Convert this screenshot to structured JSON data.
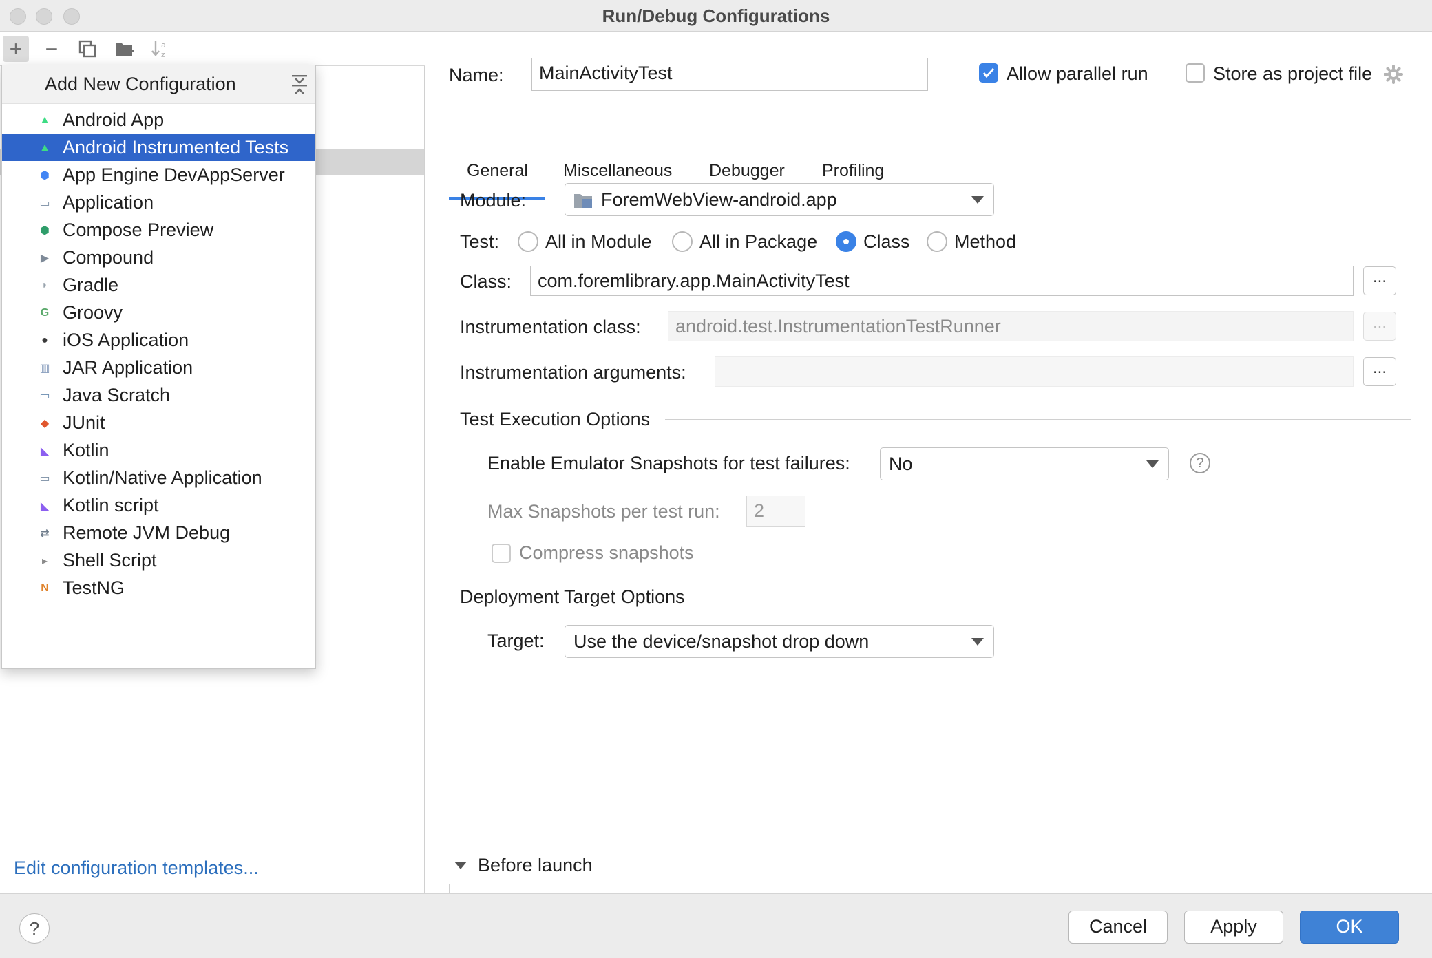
{
  "window": {
    "title": "Run/Debug Configurations"
  },
  "left": {
    "toolbar": {
      "add": "+",
      "remove": "−",
      "copy": "⧉",
      "folder": "📁",
      "sort": "↓ᵃᶻ"
    },
    "templates_link": "Edit configuration templates..."
  },
  "popup": {
    "title": "Add New Configuration",
    "items": [
      {
        "label": "Android App",
        "icon": "android-icon",
        "color": "#3ddc84"
      },
      {
        "label": "Android Instrumented Tests",
        "icon": "android-test-icon",
        "color": "#3ddc84",
        "selected": true
      },
      {
        "label": "App Engine DevAppServer",
        "icon": "app-engine-icon",
        "color": "#4285f4"
      },
      {
        "label": "Application",
        "icon": "application-icon",
        "color": "#7a8ea3"
      },
      {
        "label": "Compose Preview",
        "icon": "compose-icon",
        "color": "#2f9d6a"
      },
      {
        "label": "Compound",
        "icon": "compound-icon",
        "color": "#7e8a98"
      },
      {
        "label": "Gradle",
        "icon": "gradle-icon",
        "color": "#98a3ad"
      },
      {
        "label": "Groovy",
        "icon": "groovy-icon",
        "color": "#59a869"
      },
      {
        "label": "iOS Application",
        "icon": "apple-icon",
        "color": "#3a3a3a"
      },
      {
        "label": "JAR Application",
        "icon": "jar-icon",
        "color": "#8da2c0"
      },
      {
        "label": "Java Scratch",
        "icon": "java-scratch-icon",
        "color": "#6a8cb0"
      },
      {
        "label": "JUnit",
        "icon": "junit-icon",
        "color": "#e0572e"
      },
      {
        "label": "Kotlin",
        "icon": "kotlin-icon",
        "color": "#8c5ff0"
      },
      {
        "label": "Kotlin/Native Application",
        "icon": "kotlin-native-icon",
        "color": "#7a8ea3"
      },
      {
        "label": "Kotlin script",
        "icon": "kotlin-script-icon",
        "color": "#8c5ff0"
      },
      {
        "label": "Remote JVM Debug",
        "icon": "remote-debug-icon",
        "color": "#6f7d8c"
      },
      {
        "label": "Shell Script",
        "icon": "shell-icon",
        "color": "#8a8a8a"
      },
      {
        "label": "TestNG",
        "icon": "testng-icon",
        "color": "#e0842e"
      }
    ]
  },
  "config": {
    "name_label": "Name:",
    "name_value": "MainActivityTest",
    "allow_parallel_label": "Allow parallel run",
    "allow_parallel_checked": true,
    "store_project_label": "Store as project file",
    "store_project_checked": false,
    "tabs": [
      "General",
      "Miscellaneous",
      "Debugger",
      "Profiling"
    ],
    "active_tab": "General",
    "module_label": "Module:",
    "module_value": "ForemWebView-android.app",
    "test_label": "Test:",
    "test_options": [
      "All in Module",
      "All in Package",
      "Class",
      "Method"
    ],
    "test_selected": "Class",
    "class_label": "Class:",
    "class_value": "com.foremlibrary.app.MainActivityTest",
    "instr_class_label": "Instrumentation class:",
    "instr_class_value": "android.test.InstrumentationTestRunner",
    "instr_args_label": "Instrumentation arguments:",
    "instr_args_value": "",
    "dots": "...",
    "test_exec_heading": "Test Execution Options",
    "snapshots_label": "Enable Emulator Snapshots for test failures:",
    "snapshots_value": "No",
    "help_glyph": "?",
    "max_snapshots_label": "Max Snapshots per test run:",
    "max_snapshots_value": "2",
    "compress_label": "Compress snapshots",
    "deploy_heading": "Deployment Target Options",
    "target_label": "Target:",
    "target_value": "Use the device/snapshot drop down",
    "before_launch_label": "Before launch"
  },
  "buttons": {
    "help": "?",
    "cancel": "Cancel",
    "apply": "Apply",
    "ok": "OK"
  }
}
